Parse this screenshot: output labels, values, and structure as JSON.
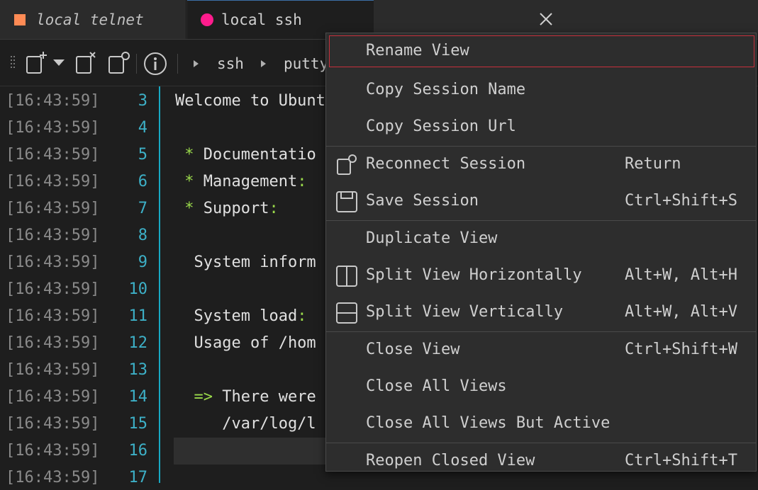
{
  "tabs": [
    {
      "label": "local telnet",
      "color": "#ff8b55"
    },
    {
      "label": "local ssh",
      "color": "#ff1c8d"
    }
  ],
  "toolbar": {
    "breadcrumbs": [
      "ssh",
      "putty"
    ]
  },
  "terminal": {
    "rows": [
      {
        "ts": "[16:43:59]",
        "ln": "3",
        "text": "Welcome to Ubunt"
      },
      {
        "ts": "[16:43:59]",
        "ln": "4",
        "text": ""
      },
      {
        "ts": "[16:43:59]",
        "ln": "5",
        "star": " * ",
        "text": "Documentatio"
      },
      {
        "ts": "[16:43:59]",
        "ln": "6",
        "star": " * ",
        "text": "Management",
        "colon": ":"
      },
      {
        "ts": "[16:43:59]",
        "ln": "7",
        "star": " * ",
        "text": "Support",
        "colon": ":"
      },
      {
        "ts": "[16:43:59]",
        "ln": "8",
        "text": ""
      },
      {
        "ts": "[16:43:59]",
        "ln": "9",
        "text": "  System inform"
      },
      {
        "ts": "[16:43:59]",
        "ln": "10",
        "text": ""
      },
      {
        "ts": "[16:43:59]",
        "ln": "11",
        "text": "  System load",
        "colon": ":"
      },
      {
        "ts": "[16:43:59]",
        "ln": "12",
        "text": "  Usage of /hom"
      },
      {
        "ts": "[16:43:59]",
        "ln": "13",
        "text": ""
      },
      {
        "ts": "[16:43:59]",
        "ln": "14",
        "arrow": "  => ",
        "text": "There were"
      },
      {
        "ts": "[16:43:59]",
        "ln": "15",
        "text": "     /var/log/l"
      },
      {
        "ts": "[16:43:59]",
        "ln": "16",
        "text": ""
      },
      {
        "ts": "[16:43:59]",
        "ln": "17",
        "text": ""
      }
    ]
  },
  "context_menu": {
    "items": [
      {
        "label": "Rename View",
        "shortcut": "",
        "icon": "",
        "highlighted": true
      },
      {
        "label": "Copy Session Name",
        "shortcut": "",
        "icon": ""
      },
      {
        "label": "Copy Session Url",
        "shortcut": "",
        "icon": ""
      },
      {
        "label": "Reconnect Session",
        "shortcut": "Return",
        "icon": "reconnect-icon"
      },
      {
        "label": "Save Session",
        "shortcut": "Ctrl+Shift+S",
        "icon": "save-icon"
      },
      {
        "label": "Duplicate View",
        "shortcut": "",
        "icon": ""
      },
      {
        "label": "Split View Horizontally",
        "shortcut": "Alt+W, Alt+H",
        "icon": "split-horizontal-icon"
      },
      {
        "label": "Split View Vertically",
        "shortcut": "Alt+W, Alt+V",
        "icon": "split-vertical-icon"
      },
      {
        "label": "Close View",
        "shortcut": "Ctrl+Shift+W",
        "icon": ""
      },
      {
        "label": "Close All Views",
        "shortcut": "",
        "icon": ""
      },
      {
        "label": "Close All Views But Active",
        "shortcut": "",
        "icon": ""
      },
      {
        "label": "Reopen Closed View",
        "shortcut": "Ctrl+Shift+T",
        "icon": ""
      }
    ]
  },
  "colors": {
    "accent_line": "#17a8c3",
    "line_numbers": "#3db0c7",
    "highlight_border": "#c8303c",
    "green_text": "#9ad94b"
  }
}
